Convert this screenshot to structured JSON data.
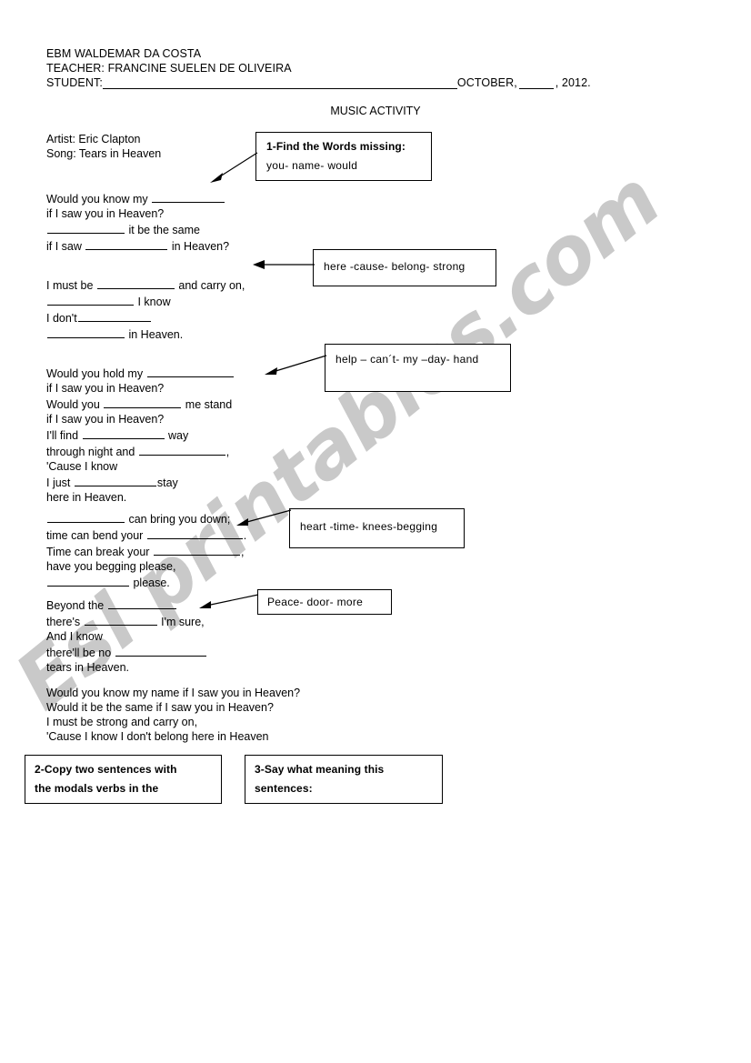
{
  "document": {
    "school": "EBM WALDEMAR DA COSTA",
    "teacher_line": "TEACHER: FRANCINE SUELEN DE OLIVEIRA",
    "student_label": "STUDENT:",
    "date_month": "OCTOBER,",
    "date_year": ", 2012.",
    "activity_title": "MUSIC ACTIVITY",
    "artist_line": "Artist: Eric  Clapton",
    "song_line": "Song: Tears in Heaven"
  },
  "boxes": {
    "task1": {
      "heading": "1-Find the Words missing:",
      "words": "you- name- would"
    },
    "hint2": {
      "words": "here -cause- belong- strong"
    },
    "hint3": {
      "words": "help – can´t- my –day- hand"
    },
    "hint4": {
      "words": "heart -time- knees-begging"
    },
    "hint5": {
      "words": "Peace- door- more"
    },
    "task2": {
      "line1": "2-Copy  two sentences with",
      "line2": "the  modals verbs in the"
    },
    "task3": {
      "line1": "3-Say what meaning this",
      "line2": "sentences:"
    }
  },
  "lyrics": {
    "stanza1": [
      {
        "pre": "Would you know my ",
        "blank": 80,
        "post": ""
      },
      {
        "pre": "if I saw you in Heaven?",
        "blank": 0,
        "post": ""
      },
      {
        "pre": "",
        "blank": 85,
        "post": " it be the same"
      },
      {
        "pre": "if I saw ",
        "blank": 90,
        "post": " in Heaven?"
      }
    ],
    "stanza2": [
      {
        "pre": "I must be ",
        "blank": 85,
        "post": " and carry on,"
      },
      {
        "pre": "",
        "blank": 95,
        "post": " I know"
      },
      {
        "pre": "I don't",
        "blank": 80,
        "post": ""
      },
      {
        "pre": "",
        "blank": 85,
        "post": " in Heaven."
      }
    ],
    "stanza3": [
      {
        "pre": "Would you hold my ",
        "blank": 95,
        "post": ""
      },
      {
        "pre": "if I saw you in Heaven?",
        "blank": 0,
        "post": ""
      },
      {
        "pre": "Would you ",
        "blank": 85,
        "post": " me stand"
      },
      {
        "pre": "if I saw you in Heaven?",
        "blank": 0,
        "post": ""
      },
      {
        "pre": "I'll find ",
        "blank": 90,
        "post": " way"
      },
      {
        "pre": "through night and ",
        "blank": 95,
        "post": ","
      },
      {
        "pre": "'Cause I know",
        "blank": 0,
        "post": ""
      },
      {
        "pre": "I just ",
        "blank": 90,
        "post": "stay"
      },
      {
        "pre": "here in Heaven.",
        "blank": 0,
        "post": ""
      }
    ],
    "stanza4": [
      {
        "pre": "",
        "blank": 85,
        "post": " can bring you down;"
      },
      {
        "pre": "time can bend your ",
        "blank": 105,
        "post": "."
      },
      {
        "pre": "Time can break your ",
        "blank": 95,
        "post": ","
      },
      {
        "pre": "have you begging please,",
        "blank": 0,
        "post": ""
      },
      {
        "pre": "",
        "blank": 90,
        "post": " please."
      }
    ],
    "stanza5": [
      {
        "pre": "Beyond the ",
        "blank": 75,
        "post": ""
      },
      {
        "pre": "there's ",
        "blank": 80,
        "post": " I'm sure,"
      },
      {
        "pre": "And I know",
        "blank": 0,
        "post": ""
      },
      {
        "pre": "there'll be no ",
        "blank": 100,
        "post": ""
      },
      {
        "pre": "tears in Heaven.",
        "blank": 0,
        "post": ""
      }
    ],
    "chorus": [
      "Would you know my name if I saw you in Heaven?",
      "Would it be the same if I saw you in Heaven?",
      "I must be strong and carry on,",
      "'Cause I know I don't belong here in Heaven"
    ]
  },
  "watermark": {
    "text": "Esl printables.com",
    "color": "#c9c9c9"
  }
}
